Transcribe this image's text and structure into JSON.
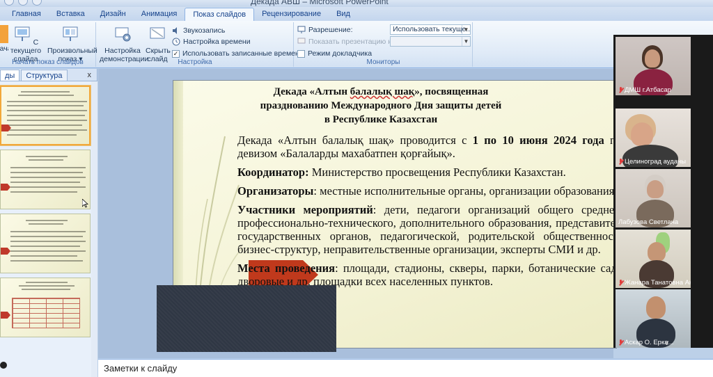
{
  "window": {
    "title": "Декада АВШ – Microsoft PowerPoint"
  },
  "tabs": [
    "Главная",
    "Вставка",
    "Дизайн",
    "Анимация",
    "Показ слайдов",
    "Рецензирование",
    "Вид"
  ],
  "active_tab": "Показ слайдов",
  "ribbon": {
    "start_group": {
      "label": "Начать показ слайдов",
      "from_current": "С текущего слайда",
      "custom": "Произвольный показ ▾",
      "first_partial": "Нача"
    },
    "setup_group": {
      "label": "Настройка",
      "setup_show": "Настройка демонстрации",
      "hide_slide": "Скрыть слайд",
      "record_narration": "Звукозапись",
      "rehearse": "Настройка времени",
      "use_timings": "Использовать записанные времена",
      "use_timings_checked": true
    },
    "monitors_group": {
      "label": "Мониторы",
      "resolution_label": "Разрешение:",
      "resolution_value": "Использовать текуще...",
      "show_on_label": "Показать презентацию на:",
      "presenter_view": "Режим докладчика",
      "presenter_view_checked": false
    }
  },
  "pane": {
    "tabs": [
      "ды",
      "Структура"
    ],
    "close": "x",
    "slide_count_visible": 4
  },
  "slide": {
    "title_line1_a": "Декада «Алтын ",
    "title_line1_u": "балалық шақ",
    "title_line1_b": "», посвященная",
    "title_line2": "празднованию Международного Дня защиты детей",
    "title_line3": "в Республике Казахстан",
    "p1_a": "Декада «Алтын балалық шақ» проводится с ",
    "p1_bold": "1 по 10 июня 2024 года",
    "p1_b": " под девизом «Балаларды махабатпен қорғайық».",
    "p2_bold": "Координатор:",
    "p2_text": " Министерство просвещения Республики Казахстан.",
    "p3_bold": "Организаторы",
    "p3_text": ": местные исполнительные органы, организации образования.",
    "p4_bold": "Участники мероприятий",
    "p4_text": ": дети, педагоги организаций общего среднего, профессионально-технического, дополнительного образования, представители государственных органов, педагогической, родительской общественности, бизнес-структур, неправительственные организации, эксперты СМИ и др.",
    "p5_bold": "Места проведения",
    "p5_text": ": площади, стадионы, скверы, парки, ботанические сады, дворовые и др. площадки всех населенных пунктов."
  },
  "notes": {
    "placeholder": "Заметки к слайду"
  },
  "participants": [
    {
      "name": "ДМШ г.Атбасар",
      "muted": true
    },
    {
      "name": "Целиноград ауданы",
      "muted": true
    },
    {
      "name": "Лабузова Светлана",
      "muted": false
    },
    {
      "name": "Жанара Танатовна Акмола",
      "muted": true
    },
    {
      "name": "Аскар О. Ерка...",
      "muted": true
    }
  ],
  "colors": {
    "accent_red": "#c0391c",
    "ribbon_blue": "#15428b",
    "slide_bg": "#f4f3d6"
  }
}
